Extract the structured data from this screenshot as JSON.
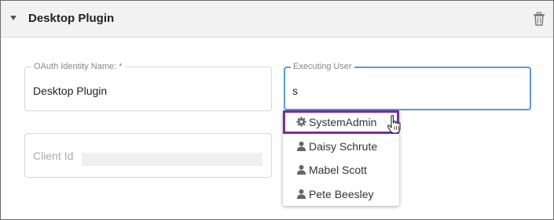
{
  "panel": {
    "title": "Desktop Plugin",
    "collapse_icon": "caret-down-icon",
    "delete_icon": "trash-icon"
  },
  "form": {
    "oauth_identity": {
      "label": "OAuth Identity Name: *",
      "value": "Desktop Plugin"
    },
    "executing_user": {
      "label": "Executing User",
      "value": "s",
      "focus_color": "#5b9bd5"
    },
    "client_id": {
      "placeholder": "Client Id"
    }
  },
  "dropdown": {
    "options": [
      {
        "label": "SystemAdmin",
        "icon": "gear-icon",
        "highlighted": true
      },
      {
        "label": "Daisy Schrute",
        "icon": "user-icon",
        "highlighted": false
      },
      {
        "label": "Mabel Scott",
        "icon": "user-icon",
        "highlighted": false
      },
      {
        "label": "Pete Beesley",
        "icon": "user-icon",
        "highlighted": false
      }
    ],
    "highlight_color": "#7a2d9c"
  },
  "pointer": "hand-pointer-icon"
}
